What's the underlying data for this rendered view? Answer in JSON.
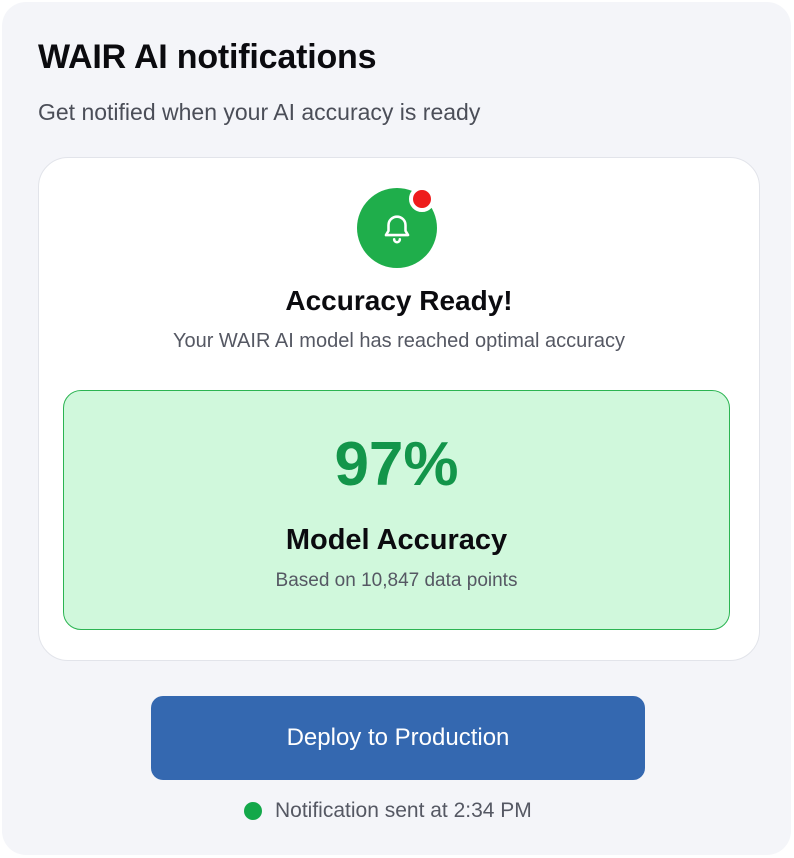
{
  "header": {
    "title": "WAIR AI notifications",
    "subtitle": "Get notified when your AI accuracy is ready"
  },
  "card": {
    "icon": "bell-icon",
    "badge_icon": "notification-dot",
    "heading": "Accuracy Ready!",
    "description": "Your WAIR AI model has reached optimal accuracy",
    "accuracy": {
      "value": "97%",
      "label": "Model Accuracy",
      "basis": "Based on 10,847 data points"
    }
  },
  "actions": {
    "deploy_label": "Deploy to Production"
  },
  "status": {
    "text": "Notification sent at 2:34 PM"
  },
  "colors": {
    "accent_green": "#1fae4b",
    "accuracy_text": "#13954a",
    "accuracy_bg": "#d0f8dc",
    "badge_red": "#ee1c1c",
    "button_blue": "#3468b0"
  }
}
